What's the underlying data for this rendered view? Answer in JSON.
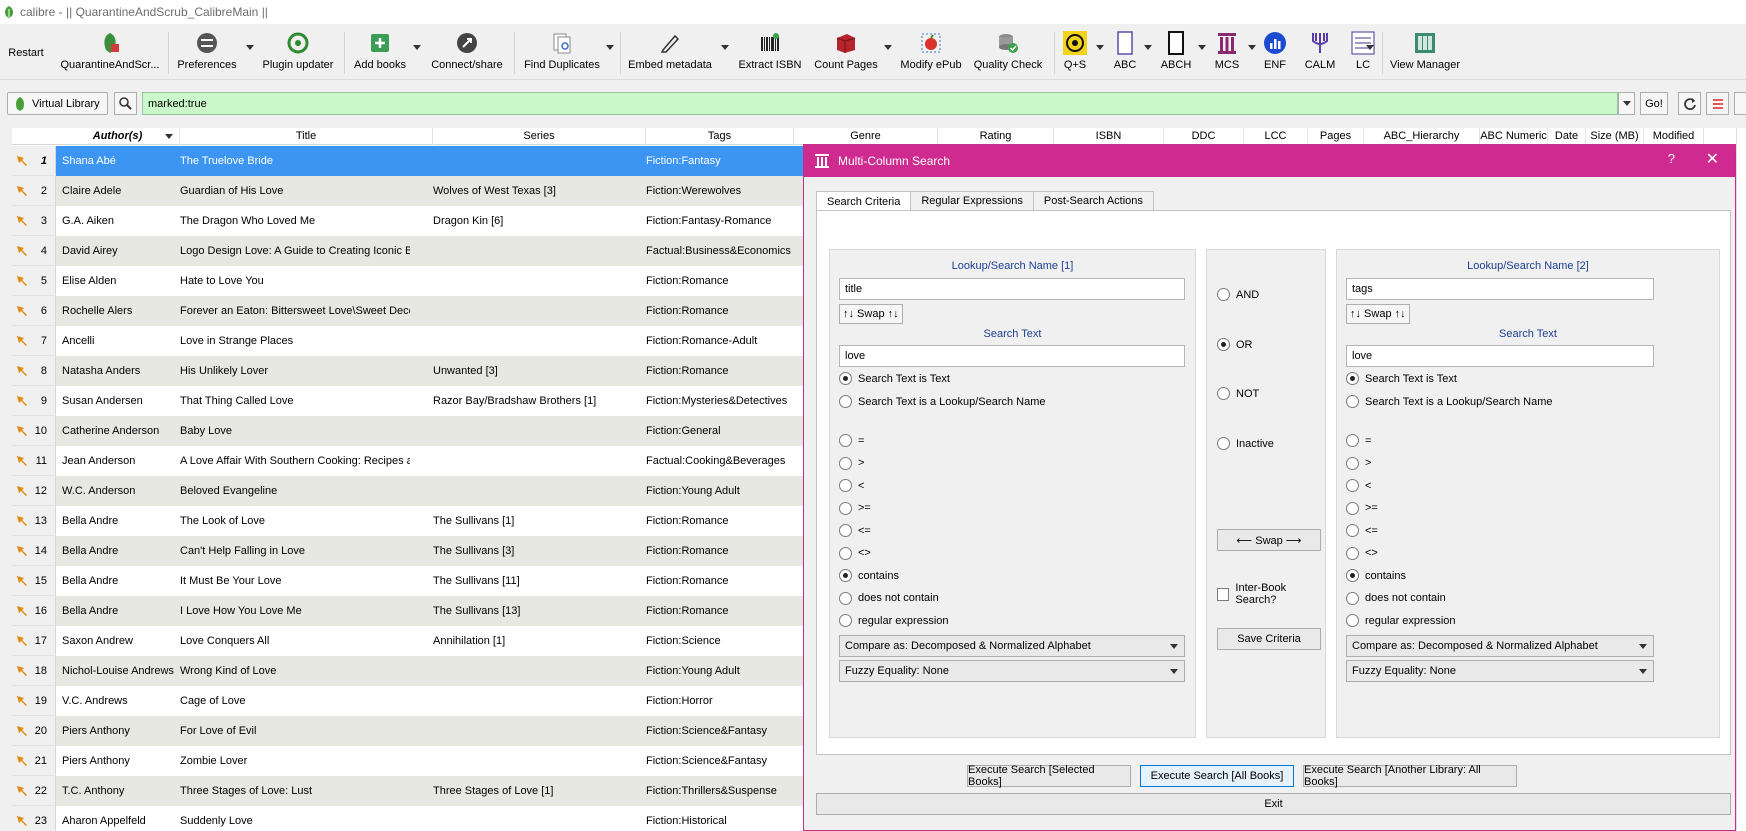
{
  "window": {
    "title": "calibre - || QuarantineAndScrub_CalibreMain ||"
  },
  "toolbar": {
    "restart": "Restart",
    "items": [
      {
        "label": "QuarantineAndScr...",
        "icon": "quarantine-icon"
      },
      {
        "label": "Preferences",
        "icon": "preferences-icon"
      },
      {
        "label": "Plugin updater",
        "icon": "plugin-updater-icon"
      },
      {
        "label": "Add books",
        "icon": "add-books-icon"
      },
      {
        "label": "Connect/share",
        "icon": "connect-share-icon"
      },
      {
        "label": "Find Duplicates",
        "icon": "find-duplicates-icon"
      },
      {
        "label": "Embed metadata",
        "icon": "embed-metadata-icon"
      },
      {
        "label": "Extract ISBN",
        "icon": "barcode-icon"
      },
      {
        "label": "Count Pages",
        "icon": "count-pages-icon"
      },
      {
        "label": "Modify ePub",
        "icon": "modify-epub-icon"
      },
      {
        "label": "Quality Check",
        "icon": "quality-check-icon"
      },
      {
        "label": "Q+S",
        "icon": "biohazard-icon"
      },
      {
        "label": "ABC",
        "icon": "abc-icon"
      },
      {
        "label": "ABCH",
        "icon": "abch-icon"
      },
      {
        "label": "MCS",
        "icon": "column-icon"
      },
      {
        "label": "ENF",
        "icon": "chart-icon"
      },
      {
        "label": "CALM",
        "icon": "calm-icon"
      },
      {
        "label": "LC",
        "icon": "lc-icon"
      },
      {
        "label": "View Manager",
        "icon": "view-manager-icon"
      }
    ]
  },
  "search": {
    "virtual_library": "Virtual Library",
    "query": "marked:true",
    "go": "Go!"
  },
  "table": {
    "columns": [
      "Author(s)",
      "Title",
      "Series",
      "Tags",
      "Genre",
      "Rating",
      "ISBN",
      "DDC",
      "LCC",
      "Pages",
      "ABC_Hierarchy",
      "ABC Numeric",
      "Date",
      "Size (MB)",
      "Modified"
    ],
    "rows": [
      {
        "num": "1",
        "author": "Shana Abé",
        "title": "The Truelove Bride",
        "series": "",
        "tags": "Fiction:Fantasy"
      },
      {
        "num": "2",
        "author": "Claire Adele",
        "title": "Guardian of His Love",
        "series": "Wolves of West Texas [3]",
        "tags": "Fiction:Werewolves"
      },
      {
        "num": "3",
        "author": "G.A. Aiken",
        "title": "The Dragon Who Loved Me",
        "series": "Dragon Kin [6]",
        "tags": "Fiction:Fantasy-Romance"
      },
      {
        "num": "4",
        "author": "David Airey",
        "title": "Logo Design Love: A Guide to Creating Iconic Br...",
        "series": "",
        "tags": "Factual:Business&Economics"
      },
      {
        "num": "5",
        "author": "Elise Alden",
        "title": "Hate to Love You",
        "series": "",
        "tags": "Fiction:Romance"
      },
      {
        "num": "6",
        "author": "Rochelle Alers",
        "title": "Forever an Eaton: Bittersweet Love\\Sweet Dece...",
        "series": "",
        "tags": "Fiction:Romance"
      },
      {
        "num": "7",
        "author": "Ancelli",
        "title": "Love in Strange Places",
        "series": "",
        "tags": "Fiction:Romance-Adult"
      },
      {
        "num": "8",
        "author": "Natasha Anders",
        "title": "His Unlikely Lover",
        "series": "Unwanted [3]",
        "tags": "Fiction:Romance"
      },
      {
        "num": "9",
        "author": "Susan Andersen",
        "title": "That Thing Called Love",
        "series": "Razor Bay/Bradshaw Brothers [1]",
        "tags": "Fiction:Mysteries&Detectives"
      },
      {
        "num": "10",
        "author": "Catherine Anderson",
        "title": "Baby Love",
        "series": "",
        "tags": "Fiction:General"
      },
      {
        "num": "11",
        "author": "Jean Anderson",
        "title": "A Love Affair With Southern Cooking: Recipes a...",
        "series": "",
        "tags": "Factual:Cooking&Beverages"
      },
      {
        "num": "12",
        "author": "W.C. Anderson",
        "title": "Beloved Evangeline",
        "series": "",
        "tags": "Fiction:Young Adult"
      },
      {
        "num": "13",
        "author": "Bella Andre",
        "title": "The Look of Love",
        "series": "The Sullivans [1]",
        "tags": "Fiction:Romance"
      },
      {
        "num": "14",
        "author": "Bella Andre",
        "title": "Can't Help Falling in Love",
        "series": "The Sullivans [3]",
        "tags": "Fiction:Romance"
      },
      {
        "num": "15",
        "author": "Bella Andre",
        "title": "It Must Be Your Love",
        "series": "The Sullivans [11]",
        "tags": "Fiction:Romance"
      },
      {
        "num": "16",
        "author": "Bella Andre",
        "title": "I Love How You Love Me",
        "series": "The Sullivans [13]",
        "tags": "Fiction:Romance"
      },
      {
        "num": "17",
        "author": "Saxon Andrew",
        "title": "Love Conquers All",
        "series": "Annihilation [1]",
        "tags": "Fiction:Science"
      },
      {
        "num": "18",
        "author": "Nichol-Louise Andrews",
        "title": "Wrong Kind of Love",
        "series": "",
        "tags": "Fiction:Young Adult"
      },
      {
        "num": "19",
        "author": "V.C. Andrews",
        "title": "Cage of Love",
        "series": "",
        "tags": "Fiction:Horror"
      },
      {
        "num": "20",
        "author": "Piers Anthony",
        "title": "For Love of Evil",
        "series": "",
        "tags": "Fiction:Science&Fantasy"
      },
      {
        "num": "21",
        "author": "Piers Anthony",
        "title": "Zombie Lover",
        "series": "",
        "tags": "Fiction:Science&Fantasy"
      },
      {
        "num": "22",
        "author": "T.C. Anthony",
        "title": "Three Stages of Love: Lust",
        "series": "Three Stages of Love [1]",
        "tags": "Fiction:Thrillers&Suspense"
      },
      {
        "num": "23",
        "author": "Aharon Appelfeld",
        "title": "Suddenly Love",
        "series": "",
        "tags": "Fiction:Historical"
      }
    ]
  },
  "dialog": {
    "title": "Multi-Column Search",
    "help": "?",
    "close": "✕",
    "tabs": [
      "Search Criteria",
      "Regular Expressions",
      "Post-Search Actions"
    ],
    "left": {
      "lookup_label": "Lookup/Search Name [1]",
      "lookup_value": "title",
      "swap": "↑↓ Swap ↑↓",
      "search_text_label": "Search Text",
      "search_text_value": "love",
      "mode_text": "Search Text is Text",
      "mode_lookup": "Search Text is a Lookup/Search Name",
      "compare": "Compare as: Decomposed & Normalized Alphabet",
      "fuzzy": "Fuzzy Equality: None"
    },
    "right": {
      "lookup_label": "Lookup/Search Name [2]",
      "lookup_value": "tags",
      "swap": "↑↓ Swap ↑↓",
      "search_text_label": "Search Text",
      "search_text_value": "love",
      "mode_text": "Search Text is Text",
      "mode_lookup": "Search Text is a Lookup/Search Name",
      "compare": "Compare as: Decomposed & Normalized Alphabet",
      "fuzzy": "Fuzzy Equality: None"
    },
    "operators": [
      "=",
      ">",
      "<",
      ">=",
      "<=",
      "<>",
      "contains",
      "does not contain",
      "regular expression"
    ],
    "selected_operator": "contains",
    "logic": [
      "AND",
      "OR",
      "NOT",
      "Inactive"
    ],
    "selected_logic": "OR",
    "middle_swap": "⟵ Swap ⟶",
    "inter_book": "Inter-Book Search?",
    "save_criteria": "Save Criteria",
    "exec_selected": "Execute Search [Selected Books]",
    "exec_all": "Execute Search [All Books]",
    "exec_another": "Execute Search [Another Library: All Books]",
    "exit": "Exit"
  }
}
